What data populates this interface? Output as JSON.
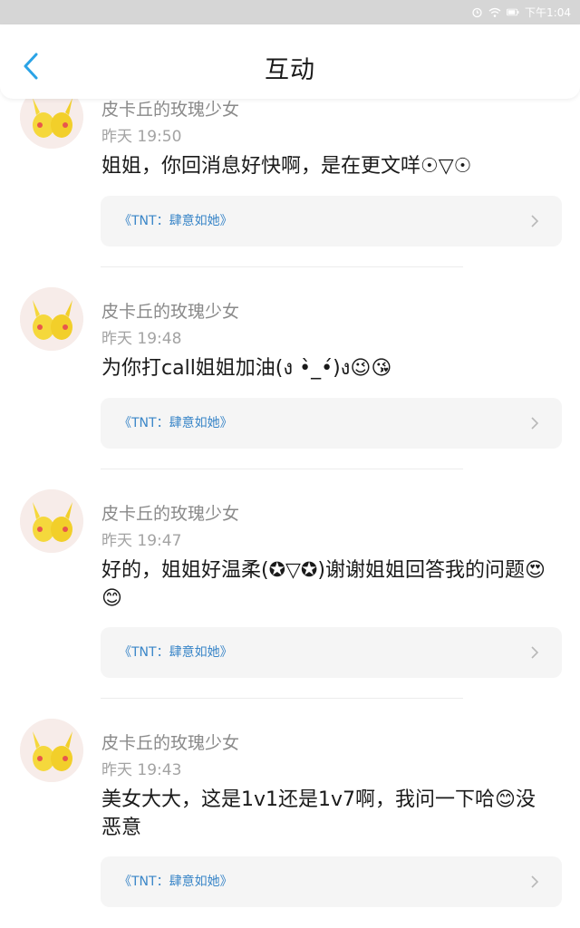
{
  "status_bar": {
    "time": "下午1:04",
    "icons": [
      "alarm-icon",
      "wifi-icon",
      "battery-icon"
    ],
    "background": "#d6d6d6"
  },
  "header": {
    "title": "互动",
    "back_icon": "chevron-left-icon",
    "accent_color": "#2aa3e6"
  },
  "comments": [
    {
      "username": "皮卡丘的玫瑰少女",
      "timestamp": "昨天 19:50",
      "text": "姐姐，你回消息好快啊，是在更文咩☉▽☉",
      "link": "《TNT：肆意如她》"
    },
    {
      "username": "皮卡丘的玫瑰少女",
      "timestamp": "昨天 19:48",
      "text": "为你打call姐姐加油(ง •̀_•́)ง😉😘",
      "link": "《TNT：肆意如她》"
    },
    {
      "username": "皮卡丘的玫瑰少女",
      "timestamp": "昨天 19:47",
      "text": "好的，姐姐好温柔(✪▽✪)谢谢姐姐回答我的问题😍😊",
      "link": "《TNT：肆意如她》"
    },
    {
      "username": "皮卡丘的玫瑰少女",
      "timestamp": "昨天 19:43",
      "text": "美女大大，这是1v1还是1v7啊，我问一下哈😊没恶意",
      "link": "《TNT：肆意如她》"
    }
  ],
  "link_color": "#3a86c8"
}
